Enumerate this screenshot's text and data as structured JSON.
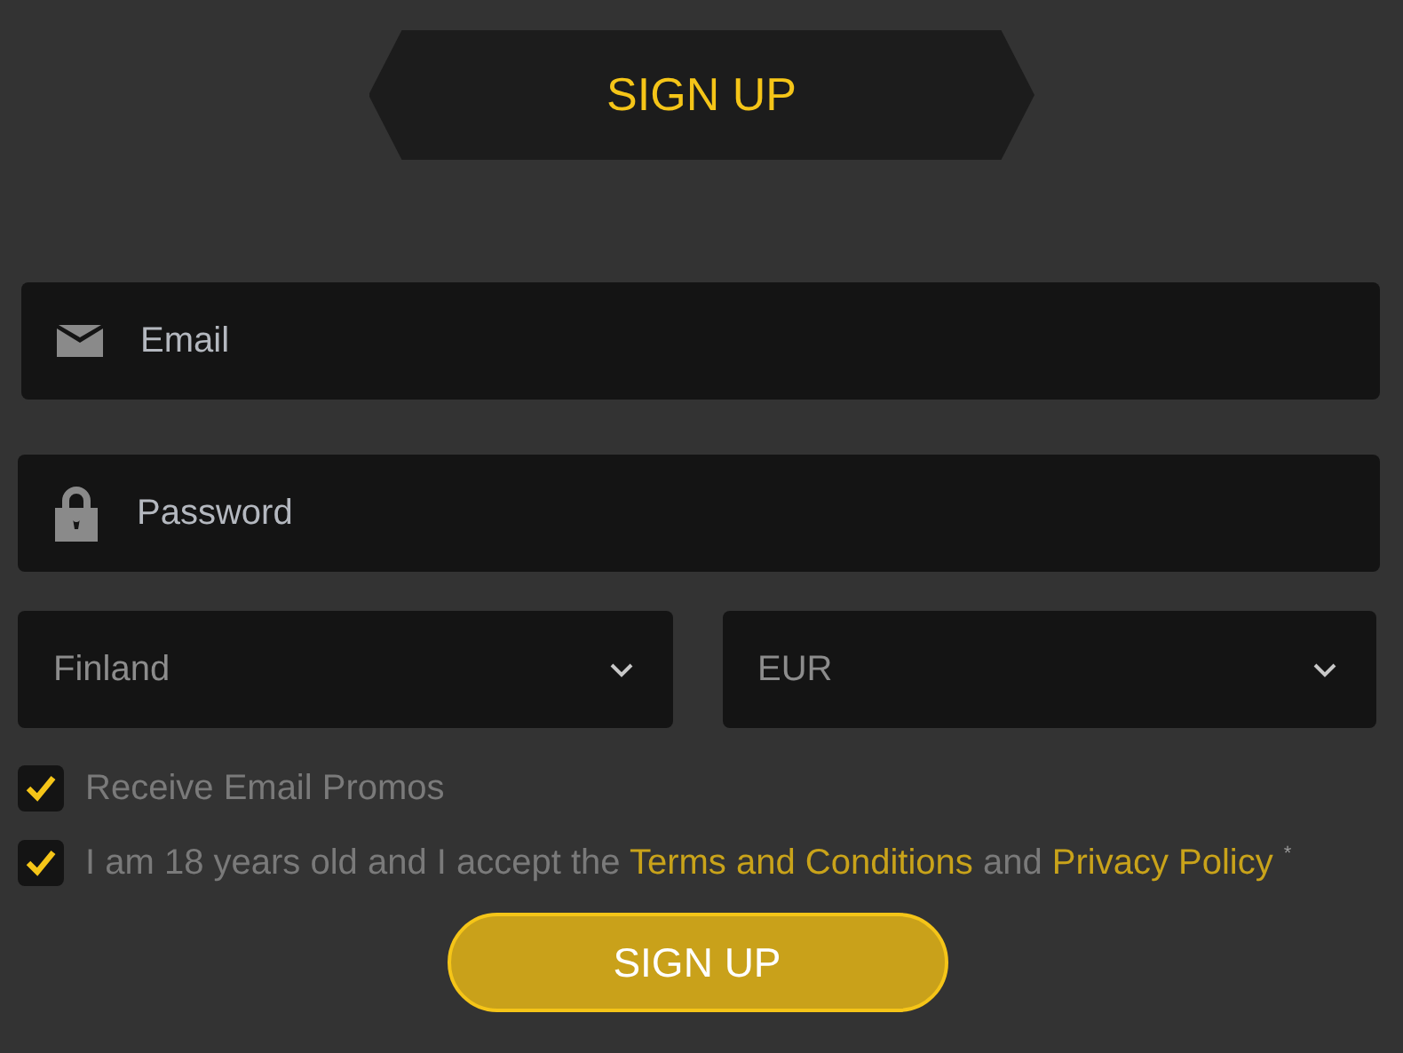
{
  "header": {
    "title": "SIGN UP"
  },
  "fields": [
    {
      "kind": "email",
      "placeholder": "Email"
    },
    {
      "kind": "password",
      "placeholder": "Password"
    }
  ],
  "selects": [
    {
      "value": "Finland"
    },
    {
      "value": "EUR"
    }
  ],
  "promos": {
    "label": "Receive Email Promos",
    "checked": true
  },
  "consent": {
    "checked": true,
    "before": "I am 18 years old and I accept the",
    "terms_link": "Terms and Conditions",
    "middle": "and",
    "privacy_link": "Privacy Policy",
    "required_mark": "*"
  },
  "submit": "SIGN UP"
}
